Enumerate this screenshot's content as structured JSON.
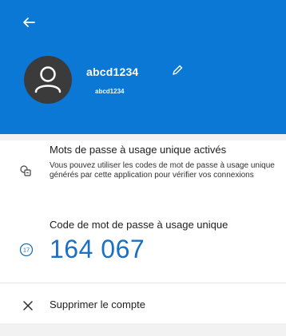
{
  "header": {
    "background": "#0b78d6",
    "back_icon": "back-arrow-icon",
    "edit_icon": "pencil-icon",
    "avatar_icon": "user-icon"
  },
  "account": {
    "name": "abcd1234",
    "subtitle": "abcd1234"
  },
  "otp": {
    "title": "Mots de passe à usage unique activés",
    "description": "Vous pouvez utiliser les codes de mot de passe à usage unique générés par cette application pour vérifier vos connexions",
    "icon": "otp-icon"
  },
  "code": {
    "label": "Code de mot de passe à usage unique",
    "value": "164 067",
    "timer_seconds": "17",
    "value_color": "#1c6fc2"
  },
  "actions": {
    "delete_label": "Supprimer le compte",
    "delete_icon": "close-icon"
  }
}
